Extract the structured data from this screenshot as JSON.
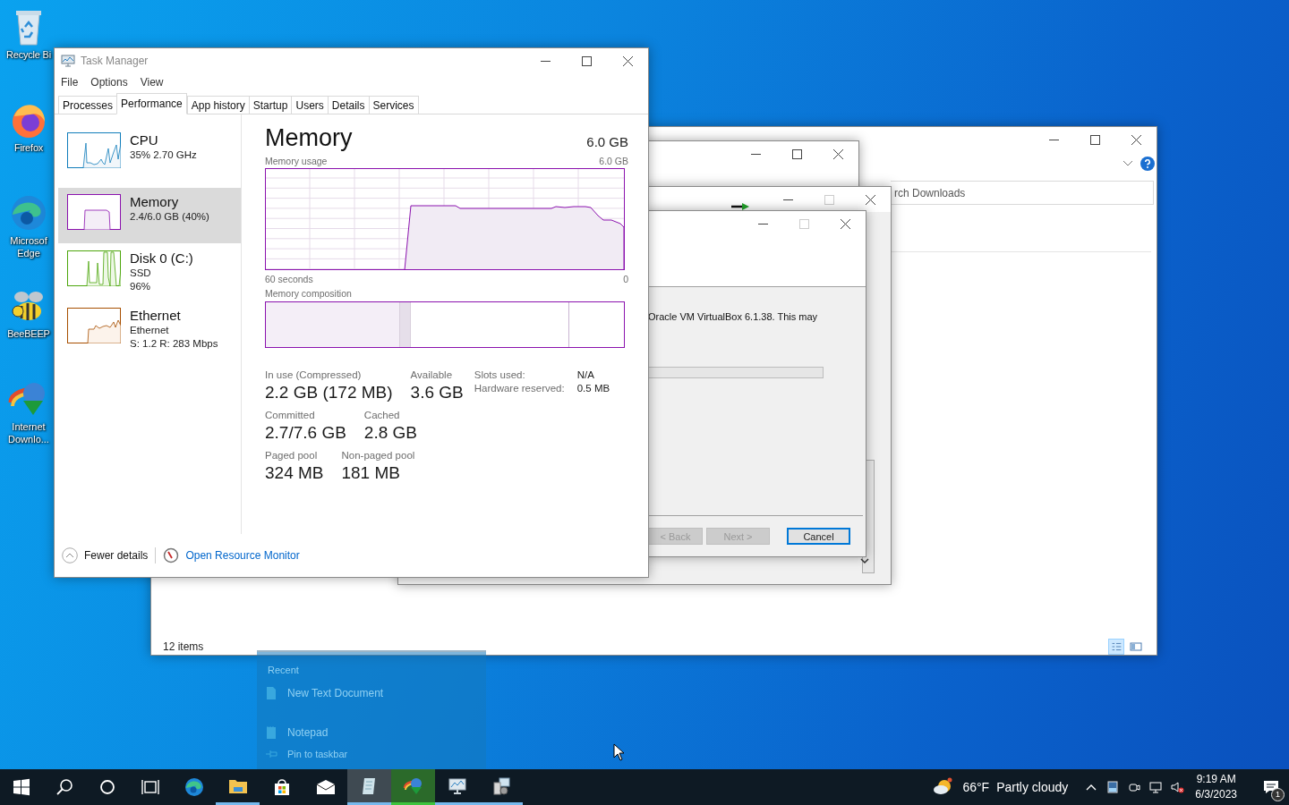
{
  "desktop_icons": [
    {
      "label": "Recycle Bi",
      "kind": "recycle"
    },
    {
      "label": "Firefox",
      "kind": "firefox"
    },
    {
      "label": "Microsof Edge",
      "kind": "edge"
    },
    {
      "label": "BeeBEEP",
      "kind": "bee"
    },
    {
      "label": "Internet Downlo...",
      "kind": "idm"
    }
  ],
  "explorer": {
    "search_placeholder": "rch Downloads",
    "status": "12 items"
  },
  "installer": {
    "message": "Oracle VM VirtualBox 6.1.38. This may",
    "buttons": [
      {
        "label": "< Back",
        "disabled": true
      },
      {
        "label": "Next >",
        "disabled": true
      },
      {
        "label": "Cancel",
        "disabled": false
      }
    ]
  },
  "task_manager": {
    "title": "Task Manager",
    "menu": [
      "File",
      "Options",
      "View"
    ],
    "tabs": [
      {
        "label": "Processes",
        "selected": false
      },
      {
        "label": "Performance",
        "selected": true
      },
      {
        "label": "App history",
        "selected": false
      },
      {
        "label": "Startup",
        "selected": false
      },
      {
        "label": "Users",
        "selected": false
      },
      {
        "label": "Details",
        "selected": false
      },
      {
        "label": "Services",
        "selected": false
      }
    ],
    "resources": [
      {
        "kind": "cpu",
        "name": "CPU",
        "lines": [
          "35%  2.70 GHz"
        ],
        "selected": false
      },
      {
        "kind": "memory",
        "name": "Memory",
        "lines": [
          "2.4/6.0 GB (40%)"
        ],
        "selected": true
      },
      {
        "kind": "disk",
        "name": "Disk 0 (C:)",
        "lines": [
          "SSD",
          "96%"
        ],
        "selected": false
      },
      {
        "kind": "ethernet",
        "name": "Ethernet",
        "lines": [
          "Ethernet",
          "S: 1.2 R: 283 Mbps"
        ],
        "selected": false
      }
    ],
    "detail": {
      "title": "Memory",
      "total": "6.0 GB",
      "usage_label": "Memory usage",
      "usage_max": "6.0 GB",
      "x_start": "60 seconds",
      "x_end": "0",
      "composition_label": "Memory composition",
      "stats": [
        [
          {
            "label": "In use (Compressed)",
            "value": "2.2 GB (172 MB)"
          },
          {
            "label": "Available",
            "value": "3.6 GB"
          }
        ],
        [
          {
            "label": "Committed",
            "value": "2.7/7.6 GB"
          },
          {
            "label": "Cached",
            "value": "2.8 GB"
          }
        ],
        [
          {
            "label": "Paged pool",
            "value": "324 MB"
          },
          {
            "label": "Non-paged pool",
            "value": "181 MB"
          }
        ]
      ],
      "side_stats": [
        {
          "label": "Slots used:",
          "value": "N/A"
        },
        {
          "label": "Hardware reserved:",
          "value": "0.5 MB"
        }
      ]
    },
    "footer": {
      "fewer_details": "Fewer details",
      "resource_monitor": "Open Resource Monitor"
    }
  },
  "jump_list": {
    "heading": "Recent",
    "items": [
      {
        "kind": "document",
        "label": "New Text Document"
      },
      {
        "kind": "notepad",
        "label": "Notepad"
      },
      {
        "kind": "pin",
        "label": "Pin to taskbar"
      }
    ]
  },
  "taskbar": {
    "apps": [
      {
        "kind": "edge",
        "running": false,
        "active": false,
        "flashing": false
      },
      {
        "kind": "folder",
        "running": true,
        "active": false,
        "flashing": false
      },
      {
        "kind": "store",
        "running": false,
        "active": false,
        "flashing": false
      },
      {
        "kind": "mail",
        "running": false,
        "active": false,
        "flashing": false
      },
      {
        "kind": "notepad",
        "running": true,
        "active": true,
        "flashing": false
      },
      {
        "kind": "idm",
        "running": true,
        "active": false,
        "flashing": true
      },
      {
        "kind": "taskmgr",
        "running": true,
        "active": false,
        "flashing": false
      },
      {
        "kind": "installer",
        "running": true,
        "active": false,
        "flashing": false
      }
    ],
    "weather": {
      "temperature": "66°F",
      "condition": "Partly cloudy"
    },
    "time": "9:19 AM",
    "date": "6/3/2023",
    "notifications": "1"
  }
}
